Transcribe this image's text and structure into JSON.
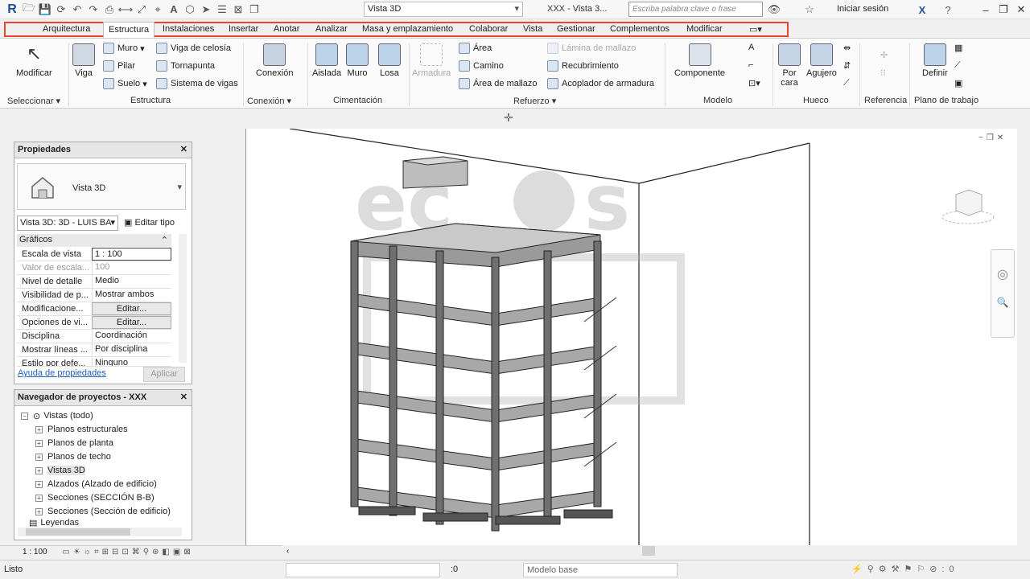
{
  "quick_access": {
    "view_selector": "Vista 3D",
    "document_title": "XXX - Vista 3...",
    "search_placeholder": "Escriba palabra clave o frase",
    "sign_in": "Iniciar sesión"
  },
  "tabs": [
    "Arquitectura",
    "Estructura",
    "Instalaciones",
    "Insertar",
    "Anotar",
    "Analizar",
    "Masa y emplazamiento",
    "Colaborar",
    "Vista",
    "Gestionar",
    "Complementos",
    "Modificar"
  ],
  "active_tab": "Estructura",
  "ribbon": {
    "modificar": "Modificar",
    "viga": "Viga",
    "muro": "Muro",
    "pilar": "Pilar",
    "suelo": "Suelo",
    "viga_celosia": "Viga de celosía",
    "tornapunta": "Tornapunta",
    "sistema_vigas": "Sistema de vigas",
    "conexion": "Conexión",
    "aislada": "Aislada",
    "muro_cim": "Muro",
    "losa": "Losa",
    "armadura": "Armadura",
    "area": "Área",
    "camino": "Camino",
    "area_mallazo": "Área de mallazo",
    "lamina_mallazo": "Lámina de mallazo",
    "recubrimiento": "Recubrimiento",
    "acoplador": "Acoplador de armadura",
    "componente": "Componente",
    "por_cara": "Por cara",
    "agujero": "Agujero",
    "definir": "Definir",
    "groups": {
      "seleccionar": "Seleccionar",
      "estructura": "Estructura",
      "conexion": "Conexión",
      "cimentacion": "Cimentación",
      "refuerzo": "Refuerzo",
      "modelo": "Modelo",
      "hueco": "Hueco",
      "referencia": "Referencia",
      "plano_trabajo": "Plano de trabajo"
    }
  },
  "properties": {
    "title": "Propiedades",
    "type_name": "Vista 3D",
    "instance": "Vista 3D: 3D - LUIS BA",
    "edit_type": "Editar tipo",
    "group": "Gráficos",
    "rows": [
      {
        "k": "Escala de vista",
        "v": "1 : 100"
      },
      {
        "k": "Valor de escala...",
        "v": "100"
      },
      {
        "k": "Nivel de detalle",
        "v": "Medio"
      },
      {
        "k": "Visibilidad de p...",
        "v": "Mostrar ambos"
      },
      {
        "k": "Modificacione...",
        "v": "Editar..."
      },
      {
        "k": "Opciones de vi...",
        "v": "Editar..."
      },
      {
        "k": "Disciplina",
        "v": "Coordinación"
      },
      {
        "k": "Mostrar líneas ...",
        "v": "Por disciplina"
      },
      {
        "k": "Estilo por defe...",
        "v": "Ninguno"
      }
    ],
    "help_link": "Ayuda de propiedades",
    "apply": "Aplicar"
  },
  "navigator": {
    "title": "Navegador de proyectos - XXX",
    "root": "Vistas (todo)",
    "items": [
      "Planos estructurales",
      "Planos de planta",
      "Planos de techo",
      "Vistas 3D",
      "Alzados (Alzado de edificio)",
      "Secciones (SECCIÓN B-B)",
      "Secciones (Sección de edificio)",
      "Leyendas"
    ]
  },
  "view_bar": {
    "scale": "1 : 100"
  },
  "status_bar": {
    "text": "Listo",
    "coord": ":0",
    "model": "Modelo base"
  }
}
